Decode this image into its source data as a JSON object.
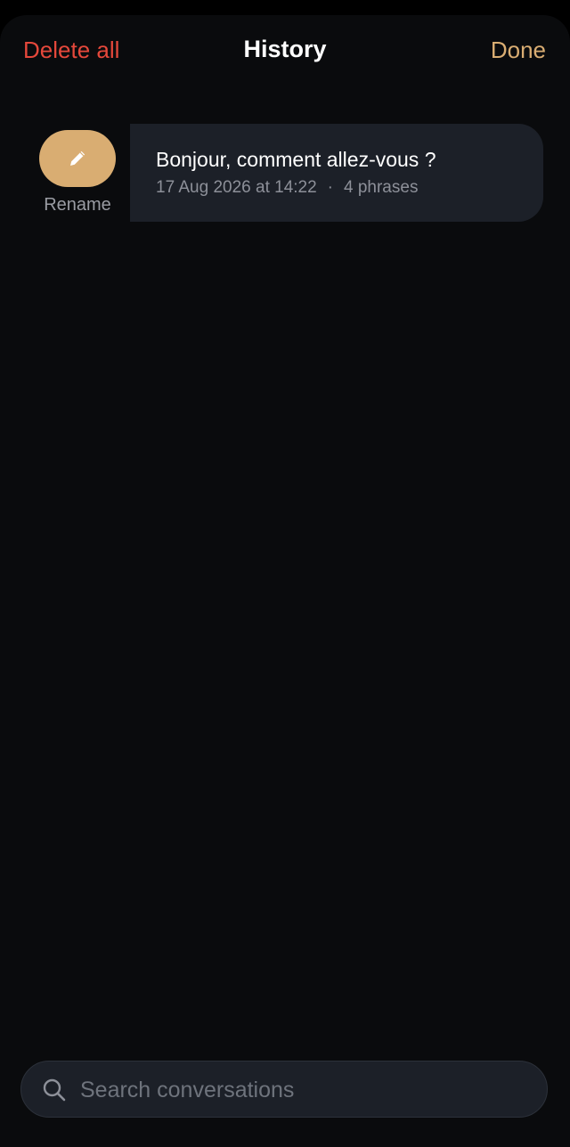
{
  "header": {
    "delete_all_label": "Delete all",
    "title": "History",
    "done_label": "Done"
  },
  "conversations": [
    {
      "title": "Bonjour, comment allez-vous ?",
      "date": "17 Aug 2026 at 14:22",
      "separator": "·",
      "phrases": "4 phrases",
      "swipe_action": {
        "label": "Rename",
        "icon": "pencil-icon"
      }
    }
  ],
  "search": {
    "placeholder": "Search conversations",
    "value": "",
    "icon": "search-icon"
  },
  "colors": {
    "background": "#0a0b0d",
    "card": "#1c2028",
    "accent": "#d9ad72",
    "destructive": "#e5483b",
    "secondary_text": "#8d9099"
  }
}
